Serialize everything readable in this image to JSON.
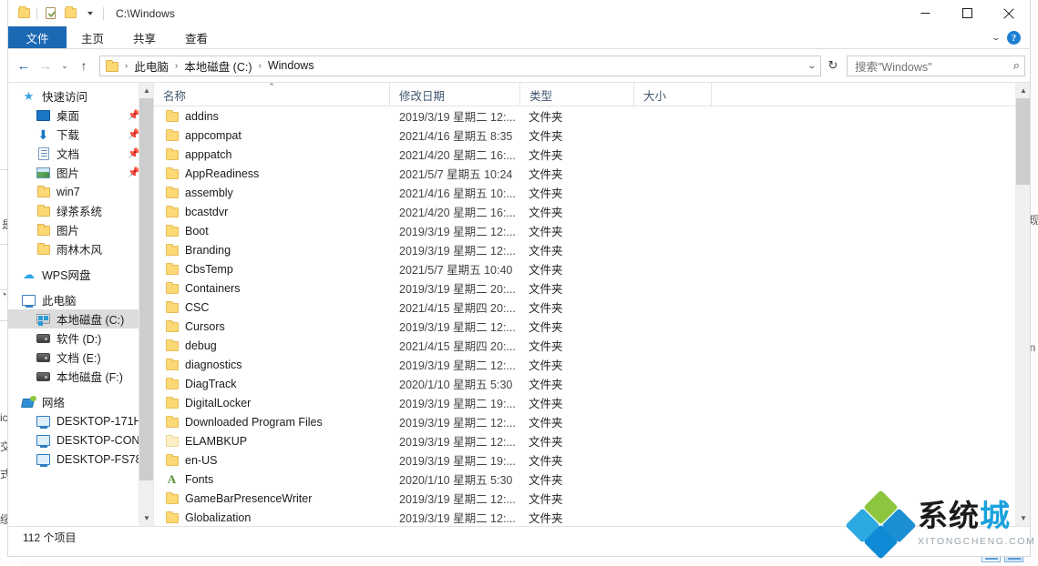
{
  "window": {
    "title": "C:\\Windows",
    "quick_access_icons": [
      "folder-icon",
      "properties-icon",
      "new-folder-icon",
      "customize-caret-icon"
    ],
    "controls": {
      "minimize": "minimize-button",
      "maximize": "maximize-button",
      "close": "close-button"
    }
  },
  "ribbon": {
    "tabs": [
      {
        "label": "文件",
        "active": true
      },
      {
        "label": "主页",
        "active": false
      },
      {
        "label": "共享",
        "active": false
      },
      {
        "label": "查看",
        "active": false
      }
    ],
    "collapse_caret": "⌄",
    "help_label": "?"
  },
  "navbar": {
    "back": "←",
    "forward": "→",
    "recent": "⌄",
    "up": "↑",
    "breadcrumbs": [
      "此电脑",
      "本地磁盘 (C:)",
      "Windows"
    ],
    "breadcrumb_separator": "›",
    "address_caret": "⌄",
    "refresh": "↻",
    "search_placeholder": "搜索\"Windows\"",
    "search_value": "",
    "search_icon": "search-icon"
  },
  "sidebar": {
    "groups": [
      {
        "name": "快速访问",
        "icon": "star-icon",
        "items": [
          {
            "label": "桌面",
            "icon": "desktop-icon",
            "pinned": true
          },
          {
            "label": "下载",
            "icon": "download-icon",
            "pinned": true
          },
          {
            "label": "文档",
            "icon": "documents-icon",
            "pinned": true
          },
          {
            "label": "图片",
            "icon": "pictures-icon",
            "pinned": true
          },
          {
            "label": "win7",
            "icon": "folder-icon",
            "pinned": false
          },
          {
            "label": "绿茶系统",
            "icon": "folder-icon",
            "pinned": false
          },
          {
            "label": "图片",
            "icon": "folder-icon",
            "pinned": false
          },
          {
            "label": "雨林木风",
            "icon": "folder-icon",
            "pinned": false
          }
        ]
      },
      {
        "name": "WPS网盘",
        "icon": "cloud-icon",
        "items": []
      },
      {
        "name": "此电脑",
        "icon": "this-pc-icon",
        "items": [
          {
            "label": "本地磁盘 (C:)",
            "icon": "drive-c-icon",
            "selected": true
          },
          {
            "label": "软件 (D:)",
            "icon": "drive-icon",
            "selected": false
          },
          {
            "label": "文档 (E:)",
            "icon": "drive-icon",
            "selected": false
          },
          {
            "label": "本地磁盘 (F:)",
            "icon": "drive-icon",
            "selected": false
          }
        ]
      },
      {
        "name": "网络",
        "icon": "network-icon",
        "items": [
          {
            "label": "DESKTOP-171H",
            "icon": "computer-icon"
          },
          {
            "label": "DESKTOP-CON",
            "icon": "computer-icon"
          },
          {
            "label": "DESKTOP-FS78",
            "icon": "computer-icon"
          }
        ]
      }
    ]
  },
  "filelist": {
    "columns": [
      {
        "label": "名称",
        "sorted": true,
        "sort_caret": "⌃"
      },
      {
        "label": "修改日期",
        "sorted": false
      },
      {
        "label": "类型",
        "sorted": false
      },
      {
        "label": "大小",
        "sorted": false
      }
    ],
    "rows": [
      {
        "name": "addins",
        "date": "2019/3/19 星期二 12:...",
        "type": "文件夹",
        "size": "",
        "icon": "folder-icon"
      },
      {
        "name": "appcompat",
        "date": "2021/4/16 星期五 8:35",
        "type": "文件夹",
        "size": "",
        "icon": "folder-icon"
      },
      {
        "name": "apppatch",
        "date": "2021/4/20 星期二 16:...",
        "type": "文件夹",
        "size": "",
        "icon": "folder-icon"
      },
      {
        "name": "AppReadiness",
        "date": "2021/5/7 星期五 10:24",
        "type": "文件夹",
        "size": "",
        "icon": "folder-icon"
      },
      {
        "name": "assembly",
        "date": "2021/4/16 星期五 10:...",
        "type": "文件夹",
        "size": "",
        "icon": "folder-icon"
      },
      {
        "name": "bcastdvr",
        "date": "2021/4/20 星期二 16:...",
        "type": "文件夹",
        "size": "",
        "icon": "folder-icon"
      },
      {
        "name": "Boot",
        "date": "2019/3/19 星期二 12:...",
        "type": "文件夹",
        "size": "",
        "icon": "folder-icon"
      },
      {
        "name": "Branding",
        "date": "2019/3/19 星期二 12:...",
        "type": "文件夹",
        "size": "",
        "icon": "folder-icon"
      },
      {
        "name": "CbsTemp",
        "date": "2021/5/7 星期五 10:40",
        "type": "文件夹",
        "size": "",
        "icon": "folder-icon"
      },
      {
        "name": "Containers",
        "date": "2019/3/19 星期二 20:...",
        "type": "文件夹",
        "size": "",
        "icon": "folder-icon"
      },
      {
        "name": "CSC",
        "date": "2021/4/15 星期四 20:...",
        "type": "文件夹",
        "size": "",
        "icon": "folder-icon"
      },
      {
        "name": "Cursors",
        "date": "2019/3/19 星期二 12:...",
        "type": "文件夹",
        "size": "",
        "icon": "folder-icon"
      },
      {
        "name": "debug",
        "date": "2021/4/15 星期四 20:...",
        "type": "文件夹",
        "size": "",
        "icon": "folder-icon"
      },
      {
        "name": "diagnostics",
        "date": "2019/3/19 星期二 12:...",
        "type": "文件夹",
        "size": "",
        "icon": "folder-icon"
      },
      {
        "name": "DiagTrack",
        "date": "2020/1/10 星期五 5:30",
        "type": "文件夹",
        "size": "",
        "icon": "folder-icon"
      },
      {
        "name": "DigitalLocker",
        "date": "2019/3/19 星期二 19:...",
        "type": "文件夹",
        "size": "",
        "icon": "folder-icon"
      },
      {
        "name": "Downloaded Program Files",
        "date": "2019/3/19 星期二 12:...",
        "type": "文件夹",
        "size": "",
        "icon": "folder-icon"
      },
      {
        "name": "ELAMBKUP",
        "date": "2019/3/19 星期二 12:...",
        "type": "文件夹",
        "size": "",
        "icon": "folder-icon-pale"
      },
      {
        "name": "en-US",
        "date": "2019/3/19 星期二 19:...",
        "type": "文件夹",
        "size": "",
        "icon": "folder-icon"
      },
      {
        "name": "Fonts",
        "date": "2020/1/10 星期五 5:30",
        "type": "文件夹",
        "size": "",
        "icon": "fonts-folder-icon"
      },
      {
        "name": "GameBarPresenceWriter",
        "date": "2019/3/19 星期二 12:...",
        "type": "文件夹",
        "size": "",
        "icon": "folder-icon"
      },
      {
        "name": "Globalization",
        "date": "2019/3/19 星期二 12:...",
        "type": "文件夹",
        "size": "",
        "icon": "folder-icon"
      }
    ]
  },
  "statusbar": {
    "item_count": "112 个项目"
  },
  "watermark": {
    "cn_dark": "系统",
    "cn_blue": "城",
    "en": "XITONGCHENG.COM"
  },
  "background_window": {
    "left_fragments": [
      "是",
      "ic",
      "交",
      "式",
      "绥"
    ],
    "right_fragments": [
      "现",
      "in"
    ]
  },
  "colors": {
    "accent": "#1b68b3",
    "selection": "#cde8ff",
    "folder": "#fcd975",
    "watermark_blue": "#19a2de",
    "watermark_green": "#8cc63f"
  }
}
